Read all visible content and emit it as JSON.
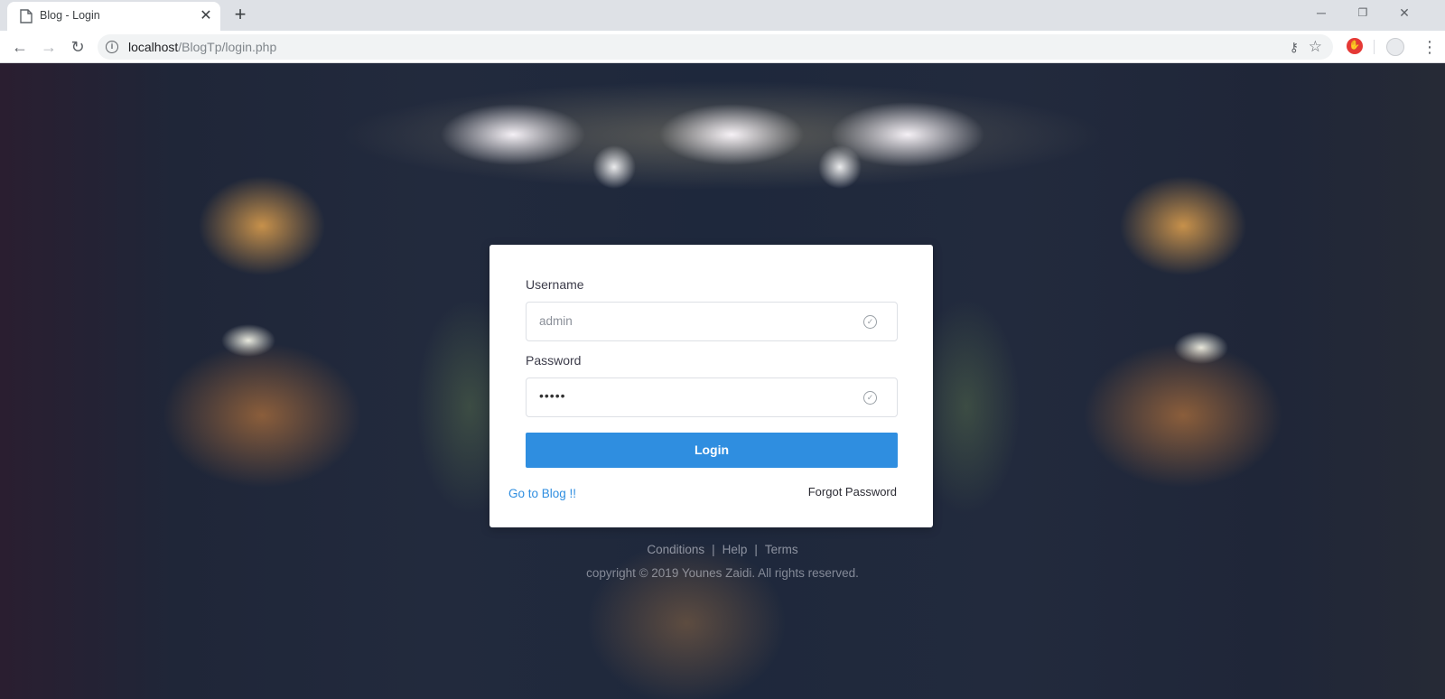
{
  "browser": {
    "tab_title": "Blog - Login",
    "tab_close": "✕",
    "new_tab": "+",
    "url_host": "localhost",
    "url_path": "/BlogTp/login.php",
    "window_controls": {
      "minimize": "─",
      "restore": "❐",
      "close": "✕"
    },
    "nav": {
      "back": "←",
      "forward": "→",
      "reload": "↻"
    },
    "icons": {
      "site_info": "i",
      "key": "⚷",
      "star": "☆",
      "menu": "⋮",
      "ext_red": "✋"
    }
  },
  "login": {
    "username_label": "Username",
    "username_value": "admin",
    "password_label": "Password",
    "password_value": "•••••",
    "login_button": "Login",
    "goto_blog": "Go to Blog !!",
    "forgot_password": "Forgot Password",
    "accent_color": "#2f8ee0"
  },
  "footer": {
    "links": [
      "Conditions",
      "Help",
      "Terms"
    ],
    "separator": "|",
    "copyright": "copyright © 2019 Younes Zaidi. All rights reserved."
  }
}
